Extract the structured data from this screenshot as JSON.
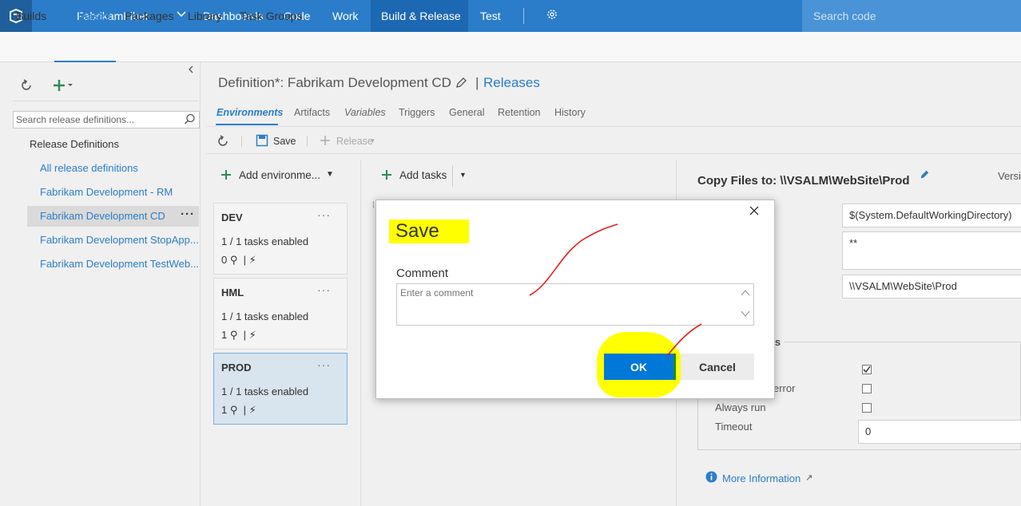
{
  "topbar": {
    "project": "FabrikamFiber",
    "nav": [
      "Dashboards",
      "Code",
      "Work",
      "Build & Release",
      "Test"
    ],
    "search_placeholder": "Search code"
  },
  "subnav": {
    "tabs": [
      "Builds",
      "Releases",
      "Packages",
      "Library",
      "Task Groups"
    ]
  },
  "leftpanel": {
    "search_placeholder": "Search release definitions...",
    "heading": "Release Definitions",
    "items": [
      "All release definitions",
      "Fabrikam Development - RM",
      "Fabrikam Development CD",
      "Fabrikam Development StopApp...",
      "Fabrikam Development TestWeb..."
    ]
  },
  "header": {
    "definition": "Definition*: Fabrikam Development CD",
    "separator": "|",
    "releases_link": "Releases"
  },
  "tabs": [
    "Environments",
    "Artifacts",
    "Variables",
    "Triggers",
    "General",
    "Retention",
    "History"
  ],
  "toolbar": {
    "save": "Save",
    "release": "Release"
  },
  "environments": {
    "add_label": "Add environme...",
    "cards": [
      {
        "name": "DEV",
        "tasks": "1 / 1 tasks enabled",
        "approvers": "0"
      },
      {
        "name": "HML",
        "tasks": "1 / 1 tasks enabled",
        "approvers": "1"
      },
      {
        "name": "PROD",
        "tasks": "1 / 1 tasks enabled",
        "approvers": "1"
      }
    ]
  },
  "tasks": {
    "add_label": "Add tasks"
  },
  "task_detail": {
    "title": "Copy Files to: \\\\VSALM\\WebSite\\Prod",
    "version_label": "Versi",
    "source": "$(System.DefaultWorkingDirectory)",
    "contents": "**",
    "target": "\\\\VSALM\\WebSite\\Prod",
    "control_options_partial": "ons",
    "continue_on_error_partial": "error",
    "always_run": "Always run",
    "timeout_label": "Timeout",
    "timeout_value": "0",
    "more_info": "More Information"
  },
  "modal": {
    "title": "Save",
    "comment_label": "Comment",
    "comment_placeholder": "Enter a comment",
    "ok": "OK",
    "cancel": "Cancel"
  },
  "colors": {
    "brand": "#2b7dc9",
    "highlight": "#ffff00",
    "annotation": "#e02020"
  }
}
